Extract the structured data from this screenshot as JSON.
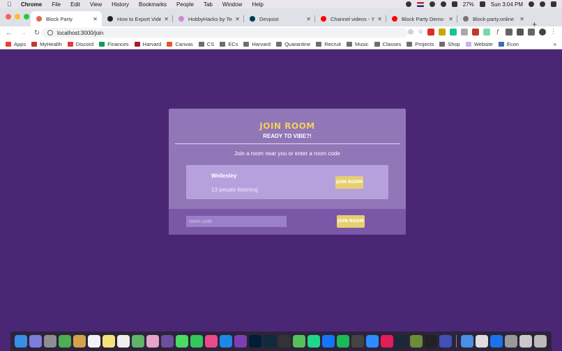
{
  "menubar": {
    "app_name": "Chrome",
    "items": [
      "File",
      "Edit",
      "View",
      "History",
      "Bookmarks",
      "People",
      "Tab",
      "Window",
      "Help"
    ],
    "battery": "27%",
    "clock": "Sun 3:04 PM"
  },
  "tabs": [
    {
      "title": "Block Party",
      "color": "#e0654c",
      "active": true
    },
    {
      "title": "How to Export Video",
      "color": "#222222",
      "active": false
    },
    {
      "title": "HobbyHacks by Tech",
      "color": "#c98bd6",
      "active": false
    },
    {
      "title": "Devpost",
      "color": "#003e54",
      "active": false
    },
    {
      "title": "Channel videos - You",
      "color": "#ff0000",
      "active": false
    },
    {
      "title": "Block Party Demo - I",
      "color": "#ff0000",
      "active": false
    },
    {
      "title": "Block-party.online",
      "color": "#777777",
      "active": false
    }
  ],
  "address_bar": {
    "url": "localhost:3000/join"
  },
  "bookmarks": [
    {
      "label": "Apps",
      "icon": "apps-grid-icon",
      "color": "#e94235"
    },
    {
      "label": "MyHealth",
      "icon": "myhealth-icon",
      "color": "#c0392b"
    },
    {
      "label": "Discord",
      "icon": "discord-icon",
      "color": "#e03b3b"
    },
    {
      "label": "Finances",
      "icon": "sheets-icon",
      "color": "#0f9d58"
    },
    {
      "label": "Harvard",
      "icon": "harvard-icon",
      "color": "#a51c30"
    },
    {
      "label": "Canvas",
      "icon": "canvas-icon",
      "color": "#e4572e"
    },
    {
      "label": "CS",
      "icon": "folder-icon",
      "color": ""
    },
    {
      "label": "ECs",
      "icon": "folder-icon",
      "color": ""
    },
    {
      "label": "Harvard",
      "icon": "folder-icon",
      "color": ""
    },
    {
      "label": "Quarantine",
      "icon": "folder-icon",
      "color": ""
    },
    {
      "label": "Recruit",
      "icon": "folder-icon",
      "color": ""
    },
    {
      "label": "Music",
      "icon": "folder-icon",
      "color": ""
    },
    {
      "label": "Classes",
      "icon": "folder-icon",
      "color": ""
    },
    {
      "label": "Projects",
      "icon": "folder-icon",
      "color": ""
    },
    {
      "label": "Shop",
      "icon": "folder-icon",
      "color": ""
    },
    {
      "label": "Website",
      "icon": "website-icon",
      "color": "#c9b3ee"
    },
    {
      "label": "Econ",
      "icon": "econ-icon",
      "color": "#3b6fb6"
    }
  ],
  "page": {
    "title": "JOIN ROOM",
    "subtitle": "READY TO VIBE?!",
    "prompt": "Join a room near you or enter a room code",
    "rooms": [
      {
        "name": "Wellesley",
        "listeners": "13 people listening",
        "button": "JOIN ROOM"
      }
    ],
    "code_placeholder": "room code",
    "code_button": "JOIN ROOM"
  },
  "colors": {
    "background": "#4a2775",
    "card": "#9176b8",
    "accent_gold": "#e6cf6f",
    "title_gold": "#f0d05a"
  },
  "dock_apps": [
    "finder",
    "siri",
    "launchpad",
    "chrome",
    "notes-app",
    "calendar",
    "stickies",
    "reminders",
    "maps",
    "photos",
    "imovie",
    "messages",
    "facetime",
    "itunes",
    "app-store",
    "onenote",
    "photoshop",
    "lightroom",
    "alfred",
    "spotify-like",
    "pycharm",
    "xcode",
    "spotify",
    "activity-monitor",
    "zoom",
    "slack",
    "steam",
    "minecraft",
    "terminal",
    "screensaver",
    "finder-2",
    "preview",
    "safari",
    "script-editor",
    "documents",
    "trash"
  ]
}
